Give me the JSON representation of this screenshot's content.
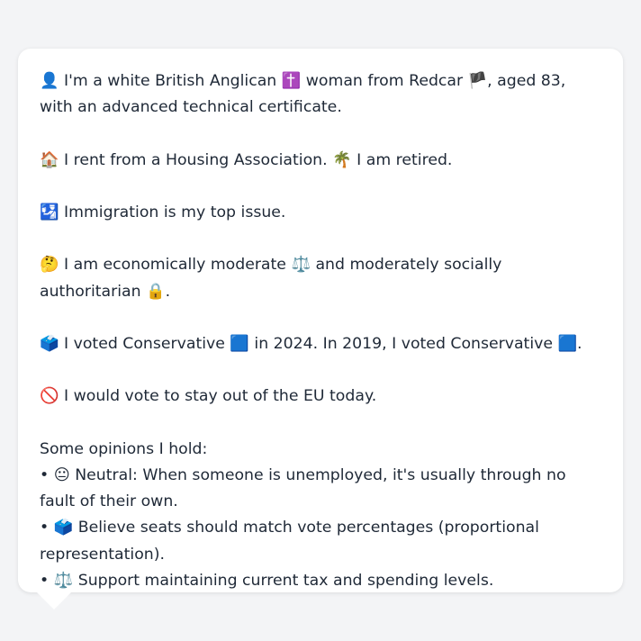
{
  "profile": {
    "identity": {
      "icon": "👤",
      "text_a": "I'm a white British Anglican",
      "religion_icon": "✝️",
      "text_b": "woman from Redcar",
      "flag_icon": "🏴",
      "text_c": ", aged 83, with an advanced technical certificate."
    },
    "housing": {
      "icon": "🏠",
      "text_a": "I rent from a Housing Association.",
      "retired_icon": "🌴",
      "text_b": "I am retired."
    },
    "top_issue": {
      "icon": "🛂",
      "text": "Immigration is my top issue."
    },
    "ideology": {
      "icon": "🤔",
      "text_a": "I am economically moderate",
      "economic_icon": "⚖️",
      "text_b": "and moderately socially authoritarian",
      "social_icon": "🔒",
      "text_c": "."
    },
    "votes": {
      "icon": "🗳️",
      "text_a": "I voted Conservative",
      "party_icon_2024": "🟦",
      "text_b": "in 2024. In 2019, I voted Conservative",
      "party_icon_2019": "🟦",
      "text_c": "."
    },
    "eu": {
      "icon": "🚫",
      "text": "I would vote to stay out of the EU today."
    },
    "opinions": {
      "heading": "Some opinions I hold:",
      "bullet": "•",
      "items": [
        {
          "icon": "😐",
          "text": "Neutral: When someone is unemployed, it's usually through no fault of their own."
        },
        {
          "icon": "🗳️",
          "text": "Believe seats should match vote percentages (proportional representation)."
        },
        {
          "icon": "⚖️",
          "text": "Support maintaining current tax and spending levels."
        }
      ]
    }
  }
}
